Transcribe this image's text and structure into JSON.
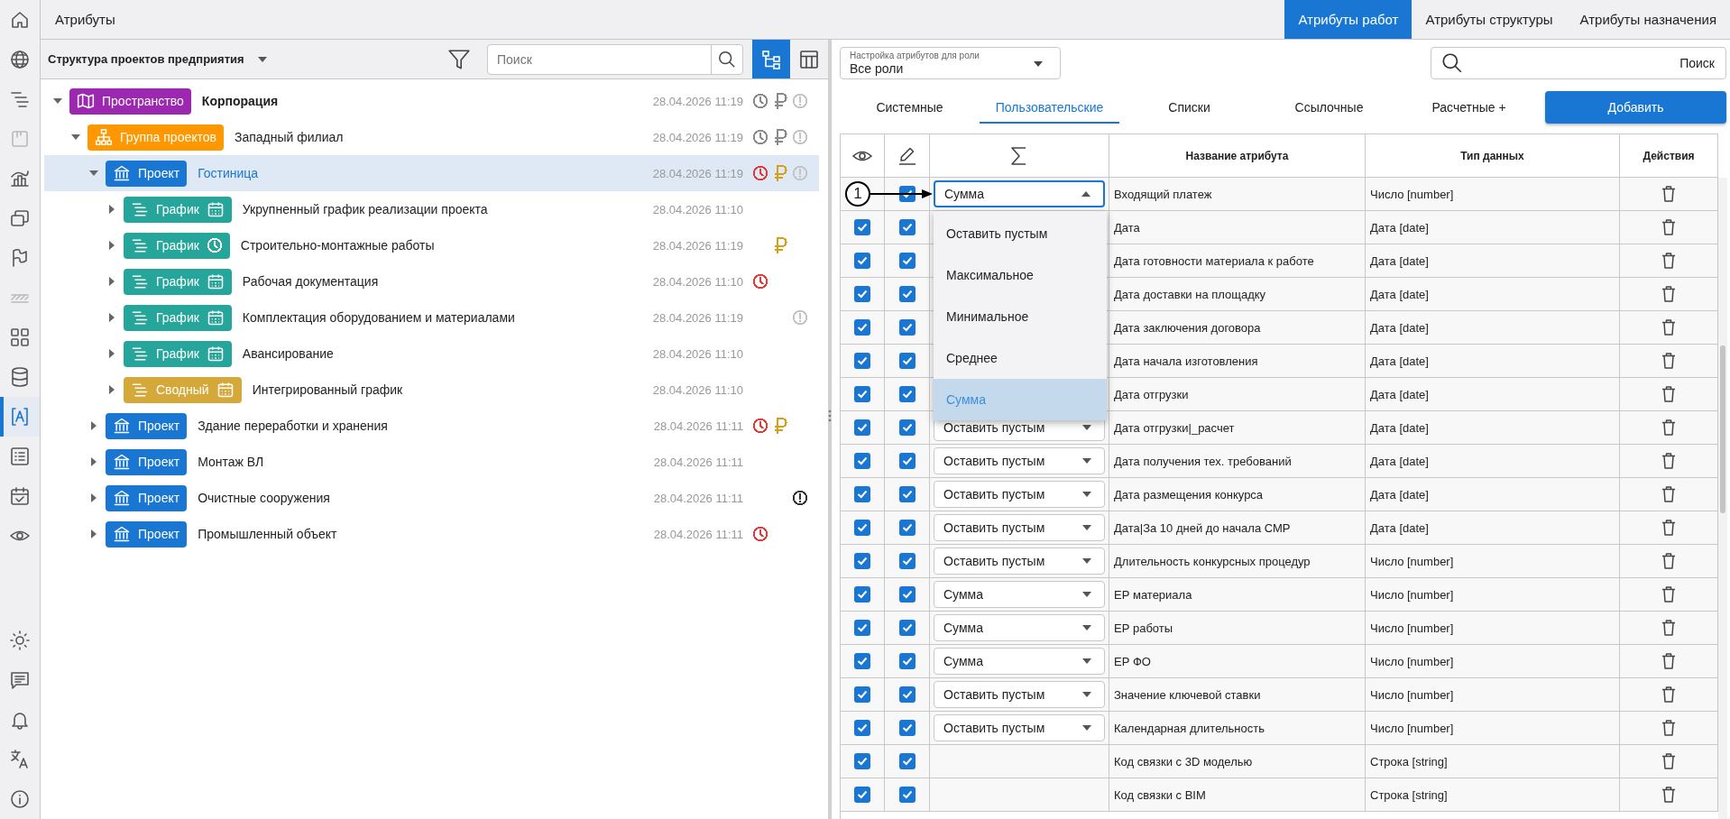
{
  "app_title": "Атрибуты",
  "top_tabs": [
    {
      "label": "Атрибуты работ",
      "selected": true
    },
    {
      "label": "Атрибуты структуры",
      "selected": false
    },
    {
      "label": "Атрибуты назначения",
      "selected": false
    }
  ],
  "sidebar": {
    "items": [
      {
        "kind": "home",
        "selected": false,
        "disabled": false
      },
      {
        "kind": "globe",
        "selected": false,
        "disabled": false
      },
      {
        "kind": "gantt",
        "selected": false,
        "disabled": false
      },
      {
        "kind": "board",
        "selected": false,
        "disabled": true
      },
      {
        "kind": "chart",
        "selected": false,
        "disabled": false
      },
      {
        "kind": "windows",
        "selected": false,
        "disabled": false
      },
      {
        "kind": "flag",
        "selected": false,
        "disabled": false
      },
      {
        "kind": "hatch",
        "selected": false,
        "disabled": true
      },
      {
        "kind": "grid",
        "selected": false,
        "disabled": false
      },
      {
        "kind": "database",
        "selected": false,
        "disabled": false
      },
      {
        "kind": "attributes",
        "selected": true,
        "disabled": false
      },
      {
        "kind": "list",
        "selected": false,
        "disabled": false
      },
      {
        "kind": "calendar",
        "selected": false,
        "disabled": false
      },
      {
        "kind": "eye",
        "selected": false,
        "disabled": false
      }
    ],
    "bottom_items": [
      {
        "kind": "sun",
        "selected": false,
        "disabled": false
      },
      {
        "kind": "chat",
        "selected": false,
        "disabled": false
      },
      {
        "kind": "bell",
        "selected": false,
        "disabled": false
      },
      {
        "kind": "translate",
        "selected": false,
        "disabled": false
      },
      {
        "kind": "info",
        "selected": false,
        "disabled": false
      }
    ]
  },
  "tree_panel": {
    "title": "Структура проектов предприятия",
    "search": {
      "placeholder": "Поиск"
    },
    "views": [
      {
        "kind": "tree",
        "selected": true
      },
      {
        "kind": "table",
        "selected": false
      }
    ]
  },
  "tree": {
    "nodes": [
      {
        "kind": "space",
        "badge": "Пространство",
        "name": "Корпорация",
        "date": "28.04.2026 11:19",
        "status": [
          {
            "kind": "clock",
            "color": "#8a8a8a"
          },
          {
            "kind": "ruble",
            "color": "#8a8a8a"
          },
          {
            "kind": "alert",
            "color": "#c4c4c4"
          }
        ],
        "expanded": true,
        "selected": false,
        "children": [
          {
            "kind": "group",
            "badge": "Группа проектов",
            "name": "Западный филиал",
            "date": "28.04.2026 11:19",
            "status": [
              {
                "kind": "clock",
                "color": "#8a8a8a"
              },
              {
                "kind": "ruble",
                "color": "#8a8a8a"
              },
              {
                "kind": "alert",
                "color": "#c4c4c4"
              }
            ],
            "expanded": true,
            "selected": false,
            "children": [
              {
                "kind": "project",
                "badge": "Проект",
                "name": "Гостиница",
                "date": "28.04.2026 11:19",
                "status": [
                  {
                    "kind": "clock",
                    "color": "#e53935"
                  },
                  {
                    "kind": "ruble",
                    "color": "#d4a017"
                  },
                  {
                    "kind": "alert",
                    "color": "#c4c4c4"
                  }
                ],
                "expanded": true,
                "selected": true,
                "children": [
                  {
                    "kind": "schedule",
                    "badge": "График",
                    "badge_icon": {
                      "kind": "calendar"
                    },
                    "name": "Укрупненный график реализации проекта",
                    "date": "28.04.2026 11:10",
                    "expanded": false,
                    "selected": false
                  },
                  {
                    "kind": "schedule",
                    "badge": "График",
                    "badge_icon": {
                      "kind": "clock"
                    },
                    "name": "Строительно-монтажные работы",
                    "date": "28.04.2026 11:19",
                    "status": [
                      {
                        "kind": "ruble",
                        "color": "#d4a017"
                      }
                    ],
                    "expanded": false,
                    "selected": false
                  },
                  {
                    "kind": "schedule",
                    "badge": "График",
                    "badge_icon": {
                      "kind": "calendar"
                    },
                    "name": "Рабочая документация",
                    "date": "28.04.2026 11:10",
                    "status": [
                      {
                        "kind": "clock",
                        "color": "#e53935"
                      }
                    ],
                    "expanded": false,
                    "selected": false
                  },
                  {
                    "kind": "schedule",
                    "badge": "График",
                    "badge_icon": {
                      "kind": "calendar"
                    },
                    "name": "Комплектация оборудованием и материалами",
                    "date": "28.04.2026 11:19",
                    "status": [
                      {
                        "kind": "alert",
                        "color": "#c4c4c4"
                      }
                    ],
                    "expanded": false,
                    "selected": false
                  },
                  {
                    "kind": "schedule",
                    "badge": "График",
                    "badge_icon": {
                      "kind": "calendar"
                    },
                    "name": "Авансирование",
                    "date": "28.04.2026 11:10",
                    "expanded": false,
                    "selected": false
                  },
                  {
                    "kind": "summary",
                    "badge": "Сводный",
                    "badge_icon": {
                      "kind": "calendar"
                    },
                    "name": "Интегрированный график",
                    "date": "28.04.2026 11:10",
                    "expanded": false,
                    "selected": false
                  }
                ]
              },
              {
                "kind": "project",
                "badge": "Проект",
                "name": "Здание переработки и хранения",
                "date": "28.04.2026 11:11",
                "status": [
                  {
                    "kind": "clock",
                    "color": "#e53935"
                  },
                  {
                    "kind": "ruble",
                    "color": "#d4a017"
                  }
                ],
                "expanded": false,
                "selected": false
              },
              {
                "kind": "project",
                "badge": "Проект",
                "name": "Монтаж ВЛ",
                "date": "28.04.2026 11:11",
                "expanded": false,
                "selected": false
              },
              {
                "kind": "project",
                "badge": "Проект",
                "name": "Очистные сооружения",
                "date": "28.04.2026 11:11",
                "status": [
                  {
                    "kind": "alert",
                    "color": "#333333"
                  }
                ],
                "expanded": false,
                "selected": false
              },
              {
                "kind": "project",
                "badge": "Проект",
                "name": "Промышленный объект",
                "date": "28.04.2026 11:11",
                "status": [
                  {
                    "kind": "clock",
                    "color": "#e53935"
                  }
                ],
                "expanded": false,
                "selected": false
              }
            ]
          }
        ]
      }
    ]
  },
  "attributes_panel": {
    "role_select": {
      "label": "Настройка атрибутов для роли",
      "value": "Все роли"
    },
    "search": {
      "placeholder": "Поиск"
    },
    "tabs": [
      {
        "label": "Системные",
        "selected": false
      },
      {
        "label": "Пользовательские",
        "selected": true
      },
      {
        "label": "Списки",
        "selected": false
      },
      {
        "label": "Ссылочные",
        "selected": false
      },
      {
        "label": "Расчетные +",
        "selected": false
      }
    ],
    "add_button": "Добавить"
  },
  "table": {
    "columns": [
      {
        "kind": "visibility"
      },
      {
        "kind": "editable"
      },
      {
        "kind": "aggregate"
      },
      {
        "kind": "text",
        "label": "Название атрибута"
      },
      {
        "kind": "text",
        "label": "Тип данных"
      },
      {
        "kind": "text",
        "label": "Действия"
      }
    ],
    "rows": [
      {
        "callout": "1",
        "editable": true,
        "aggregate": "Сумма",
        "aggregate_open": true,
        "name": "Входящий платеж",
        "type": "Число [number]"
      },
      {
        "visible": true,
        "editable": true,
        "name": "Дата",
        "type": "Дата [date]"
      },
      {
        "visible": true,
        "editable": true,
        "name": "Дата готовности материала к работе",
        "type": "Дата [date]"
      },
      {
        "visible": true,
        "editable": true,
        "name": "Дата доставки на площадку",
        "type": "Дата [date]"
      },
      {
        "visible": true,
        "editable": true,
        "name": "Дата заключения договора",
        "type": "Дата [date]"
      },
      {
        "visible": true,
        "editable": true,
        "name": "Дата начала изготовления",
        "type": "Дата [date]"
      },
      {
        "visible": true,
        "editable": true,
        "name": "Дата отгрузки",
        "type": "Дата [date]"
      },
      {
        "visible": true,
        "editable": true,
        "aggregate": "Оставить пустым",
        "aggregate_open": false,
        "name": "Дата отгрузки|_расчет",
        "type": "Дата [date]"
      },
      {
        "visible": true,
        "editable": true,
        "aggregate": "Оставить пустым",
        "aggregate_open": false,
        "name": "Дата получения тех. требований",
        "type": "Дата [date]"
      },
      {
        "visible": true,
        "editable": true,
        "aggregate": "Оставить пустым",
        "aggregate_open": false,
        "name": "Дата размещения конкурса",
        "type": "Дата [date]"
      },
      {
        "visible": true,
        "editable": true,
        "aggregate": "Оставить пустым",
        "aggregate_open": false,
        "name": "Дата|За 10 дней до начала СМР",
        "type": "Дата [date]"
      },
      {
        "visible": true,
        "editable": true,
        "aggregate": "Оставить пустым",
        "aggregate_open": false,
        "name": "Длительность конкурсных процедур",
        "type": "Число [number]"
      },
      {
        "visible": true,
        "editable": true,
        "aggregate": "Сумма",
        "aggregate_open": false,
        "name": "ЕР материала",
        "type": "Число [number]"
      },
      {
        "visible": true,
        "editable": true,
        "aggregate": "Сумма",
        "aggregate_open": false,
        "name": "ЕР работы",
        "type": "Число [number]"
      },
      {
        "visible": true,
        "editable": true,
        "aggregate": "Сумма",
        "aggregate_open": false,
        "name": "ЕР ФО",
        "type": "Число [number]"
      },
      {
        "visible": true,
        "editable": true,
        "aggregate": "Оставить пустым",
        "aggregate_open": false,
        "name": "Значение ключевой ставки",
        "type": "Число [number]"
      },
      {
        "visible": true,
        "editable": true,
        "aggregate": "Оставить пустым",
        "aggregate_open": false,
        "name": "Календарная длительность",
        "type": "Число [number]"
      },
      {
        "visible": true,
        "editable": true,
        "name": "Код связки с 3D моделью",
        "type": "Строка [string]"
      },
      {
        "visible": true,
        "editable": true,
        "name": "Код связки с BIM",
        "type": "Строка [string]"
      }
    ],
    "aggregate_menu": {
      "options": [
        {
          "label": "Оставить пустым",
          "selected": false
        },
        {
          "label": "Максимальное",
          "selected": false
        },
        {
          "label": "Минимальное",
          "selected": false
        },
        {
          "label": "Среднее",
          "selected": false
        },
        {
          "label": "Сумма",
          "selected": true
        }
      ]
    }
  }
}
